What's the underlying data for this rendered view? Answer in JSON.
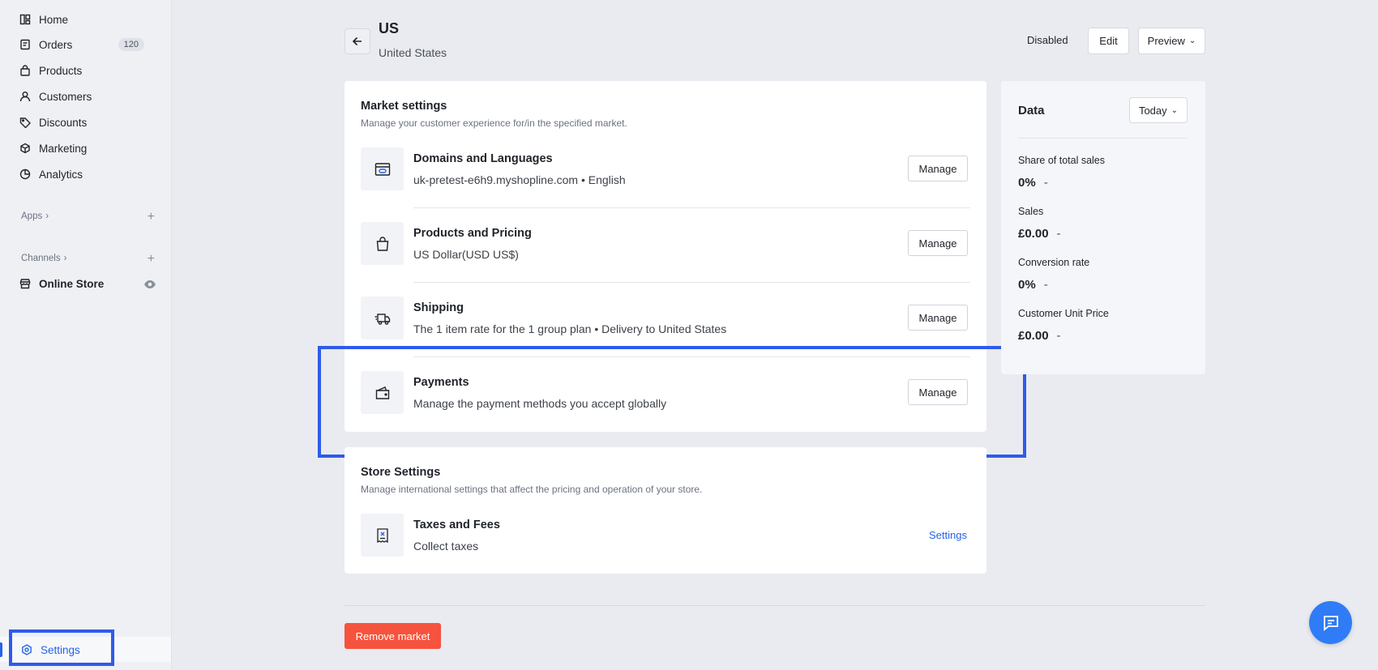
{
  "sidebar": {
    "items": [
      {
        "label": "Home",
        "icon": "home-icon"
      },
      {
        "label": "Orders",
        "icon": "orders-icon",
        "badge": "120"
      },
      {
        "label": "Products",
        "icon": "bag-icon"
      },
      {
        "label": "Customers",
        "icon": "person-icon"
      },
      {
        "label": "Discounts",
        "icon": "tag-icon"
      },
      {
        "label": "Marketing",
        "icon": "cube-icon"
      },
      {
        "label": "Analytics",
        "icon": "pie-icon"
      }
    ],
    "apps_label": "Apps",
    "channels_label": "Channels",
    "online_store_label": "Online Store",
    "settings_label": "Settings"
  },
  "header": {
    "title": "US",
    "subtitle": "United States",
    "status": "Disabled",
    "edit_label": "Edit",
    "preview_label": "Preview"
  },
  "market_settings": {
    "title": "Market settings",
    "description": "Manage your customer experience for/in the specified market.",
    "rows": [
      {
        "title": "Domains and Languages",
        "desc": "uk-pretest-e6h9.myshopline.com • English",
        "button": "Manage",
        "icon": "browser-icon"
      },
      {
        "title": "Products and Pricing",
        "desc": "US Dollar(USD US$)",
        "button": "Manage",
        "icon": "shopping-bag-icon"
      },
      {
        "title": "Shipping",
        "desc": "The 1 item rate for the 1 group plan • Delivery to United States",
        "button": "Manage",
        "icon": "truck-icon"
      },
      {
        "title": "Payments",
        "desc": "Manage the payment methods you accept globally",
        "button": "Manage",
        "icon": "wallet-icon"
      }
    ]
  },
  "store_settings": {
    "title": "Store Settings",
    "description": "Manage international settings that affect the pricing and operation of your store.",
    "row": {
      "title": "Taxes and Fees",
      "desc": "Collect taxes",
      "button": "Settings",
      "icon": "receipt-icon"
    }
  },
  "data_panel": {
    "title": "Data",
    "range_label": "Today",
    "metrics": [
      {
        "label": "Share of total sales",
        "value": "0%",
        "change": "-"
      },
      {
        "label": "Sales",
        "value": "£0.00",
        "change": "-"
      },
      {
        "label": "Conversion rate",
        "value": "0%",
        "change": "-"
      },
      {
        "label": "Customer Unit Price",
        "value": "£0.00",
        "change": "-"
      }
    ]
  },
  "remove_label": "Remove market",
  "colors": {
    "accent": "#2563eb",
    "danger": "#f5533d",
    "highlight": "#2f5bea"
  }
}
